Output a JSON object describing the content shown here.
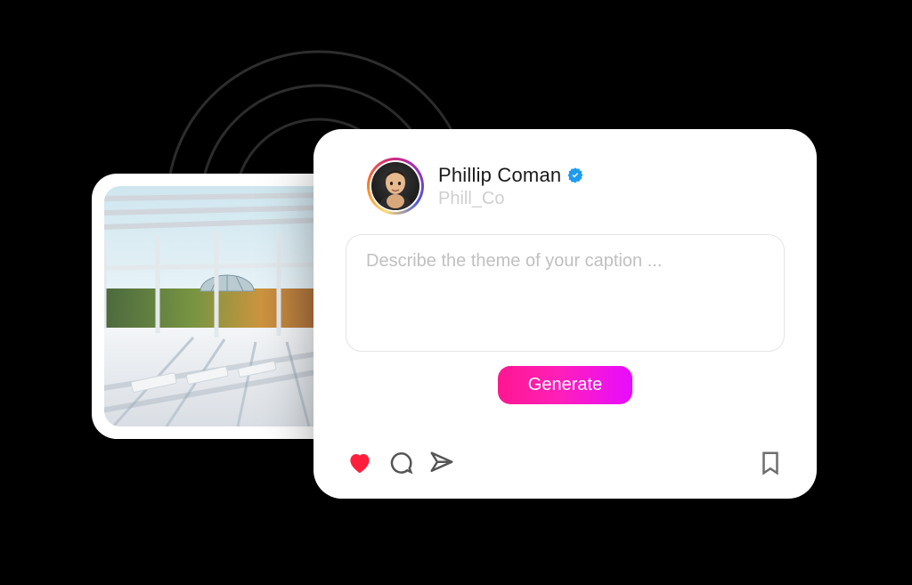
{
  "user": {
    "display_name": "Phillip Coman",
    "handle": "Phill_Co",
    "verified": true
  },
  "caption_input": {
    "placeholder": "Describe the theme of your caption ...",
    "value": ""
  },
  "buttons": {
    "generate_label": "Generate"
  },
  "icons": {
    "like": "heart-icon",
    "comment": "comment-icon",
    "share": "share-icon",
    "save": "bookmark-icon",
    "verified": "verified-badge-icon"
  },
  "colors": {
    "heart": "#ff1f3d",
    "verified": "#1d9bf0",
    "generate_gradient_start": "#ff1791",
    "generate_gradient_end": "#e80cff"
  }
}
